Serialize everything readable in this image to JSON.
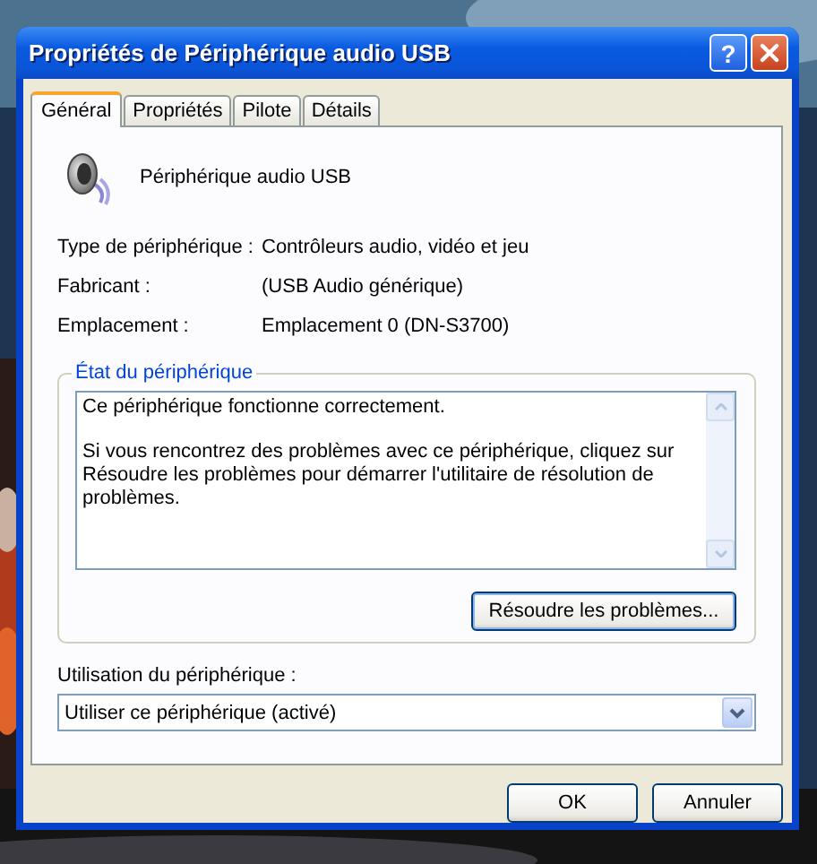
{
  "window": {
    "title": "Propriétés de Périphérique audio USB",
    "help": "?"
  },
  "tabs": [
    {
      "label": "Général",
      "selected": true
    },
    {
      "label": "Propriétés",
      "selected": false
    },
    {
      "label": "Pilote",
      "selected": false
    },
    {
      "label": "Détails",
      "selected": false
    }
  ],
  "device_name": "Périphérique audio USB",
  "properties": [
    {
      "label": "Type de périphérique :",
      "value": "Contrôleurs audio, vidéo et jeu"
    },
    {
      "label": "Fabricant :",
      "value": "(USB Audio générique)"
    },
    {
      "label": "Emplacement :",
      "value": "Emplacement 0 (DN-S3700)"
    }
  ],
  "status": {
    "legend": "État du périphérique",
    "paragraphs": [
      "Ce périphérique fonctionne correctement.",
      "Si vous rencontrez des problèmes avec ce périphérique, cliquez sur Résoudre les problèmes pour démarrer l'utilitaire de résolution de problèmes."
    ],
    "button": "Résoudre les problèmes..."
  },
  "usage": {
    "label": "Utilisation du périphérique :",
    "value": "Utiliser ce périphérique (activé)"
  },
  "buttons": [
    "OK",
    "Annuler"
  ]
}
